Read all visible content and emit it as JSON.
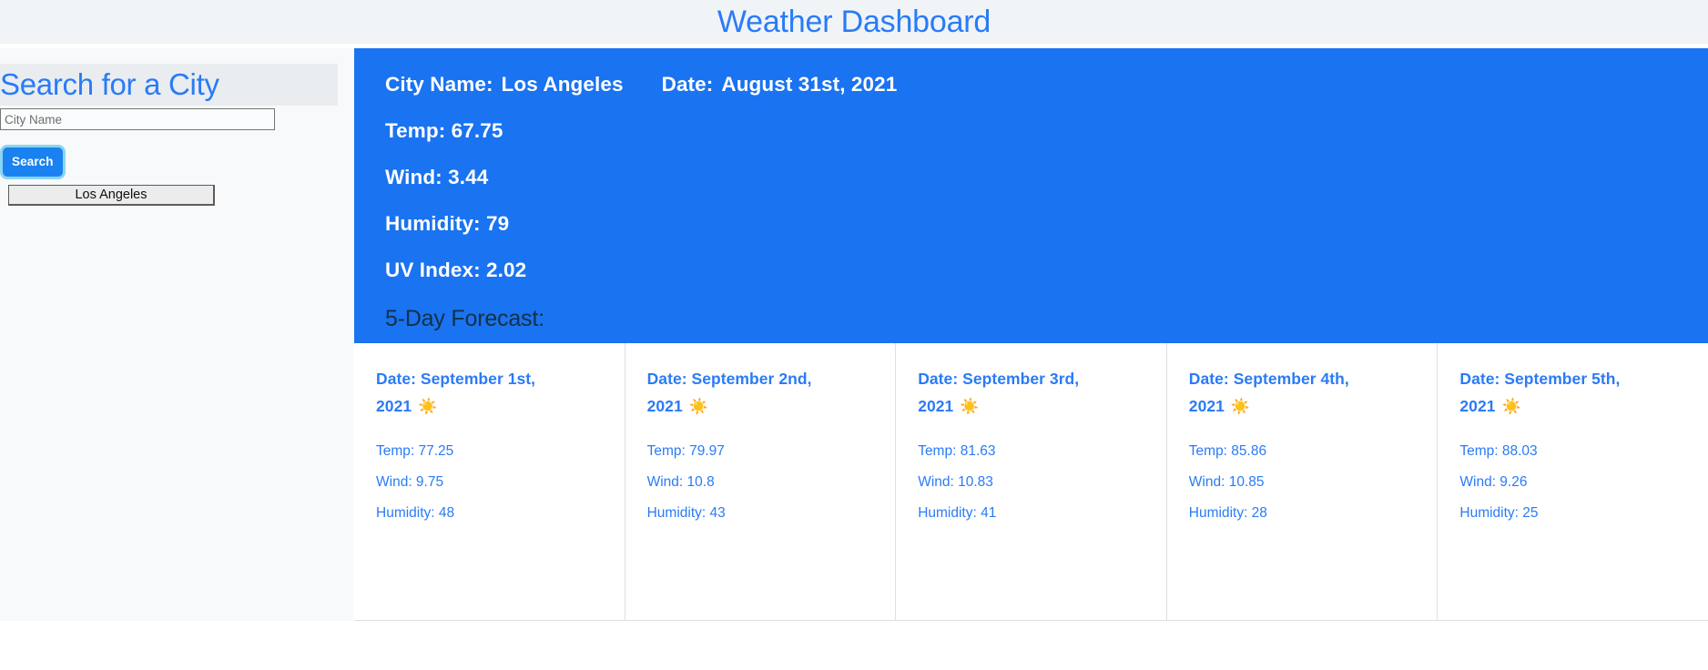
{
  "header": {
    "title": "Weather Dashboard",
    "title_color": "#2a7bf6",
    "background_color": "#f0f4f7"
  },
  "sidebar": {
    "heading": "Search for a City",
    "search_input": {
      "placeholder": "City Name",
      "value": ""
    },
    "search_button_label": "Search",
    "history": [
      {
        "label": "Los Angeles"
      }
    ]
  },
  "current_weather": {
    "city_label": "City Name:",
    "city_value": "Los Angeles",
    "date_label": "Date:",
    "date_value": "August 31st, 2021",
    "temp": "Temp: 67.75",
    "wind": "Wind: 3.44",
    "humidity": "Humidity: 79",
    "uv_index": "UV Index: 2.02",
    "card_color": "#1a73f0"
  },
  "forecast": {
    "heading": "5-Day Forecast:",
    "icon_name": "sun-icon",
    "icon_glyph": "☀️",
    "days": [
      {
        "date": "Date: September 1st, 2021",
        "temp": "Temp: 77.25",
        "wind": "Wind: 9.75",
        "humidity": "Humidity: 48"
      },
      {
        "date": "Date: September 2nd, 2021",
        "temp": "Temp: 79.97",
        "wind": "Wind: 10.8",
        "humidity": "Humidity: 43"
      },
      {
        "date": "Date: September 3rd, 2021",
        "temp": "Temp: 81.63",
        "wind": "Wind: 10.83",
        "humidity": "Humidity: 41"
      },
      {
        "date": "Date: September 4th, 2021",
        "temp": "Temp: 85.86",
        "wind": "Wind: 10.85",
        "humidity": "Humidity: 28"
      },
      {
        "date": "Date: September 5th, 2021",
        "temp": "Temp: 88.03",
        "wind": "Wind: 9.26",
        "humidity": "Humidity: 25"
      }
    ]
  }
}
